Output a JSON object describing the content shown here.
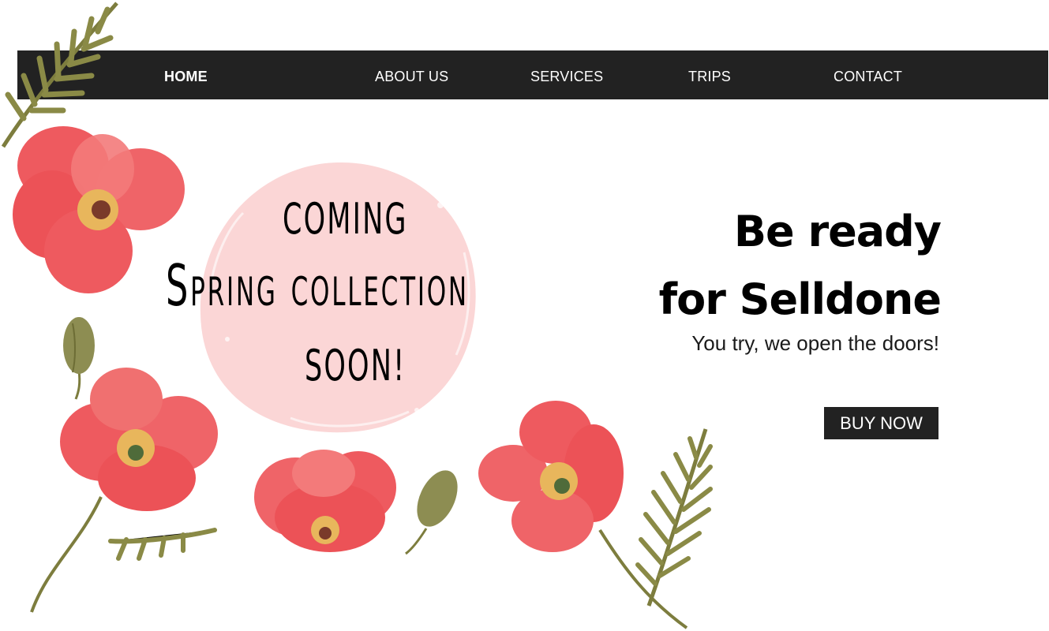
{
  "nav": {
    "items": [
      {
        "label": "HOME",
        "active": true
      },
      {
        "label": "ABOUT US",
        "active": false
      },
      {
        "label": "SERVICES",
        "active": false
      },
      {
        "label": "TRIPS",
        "active": false
      },
      {
        "label": "CONTACT",
        "active": false
      }
    ]
  },
  "hero": {
    "line1": "COMING",
    "line2": "Spring collection",
    "line3": "SOON!"
  },
  "promo": {
    "title_line1": "Be ready",
    "title_line2": "for Selldone",
    "tagline": "You try, we open the doors!",
    "button_label": "BUY NOW"
  },
  "colors": {
    "nav_bg": "#222222",
    "blob": "#fbd6d6",
    "poppy": "#ee5a5f",
    "poppy_dark": "#d93c46",
    "poppy_center": "#e8b65c",
    "leaf": "#8a8a46"
  },
  "icons": [
    "poppy-flower-icon",
    "poppy-bud-icon",
    "fern-leaf-icon"
  ]
}
